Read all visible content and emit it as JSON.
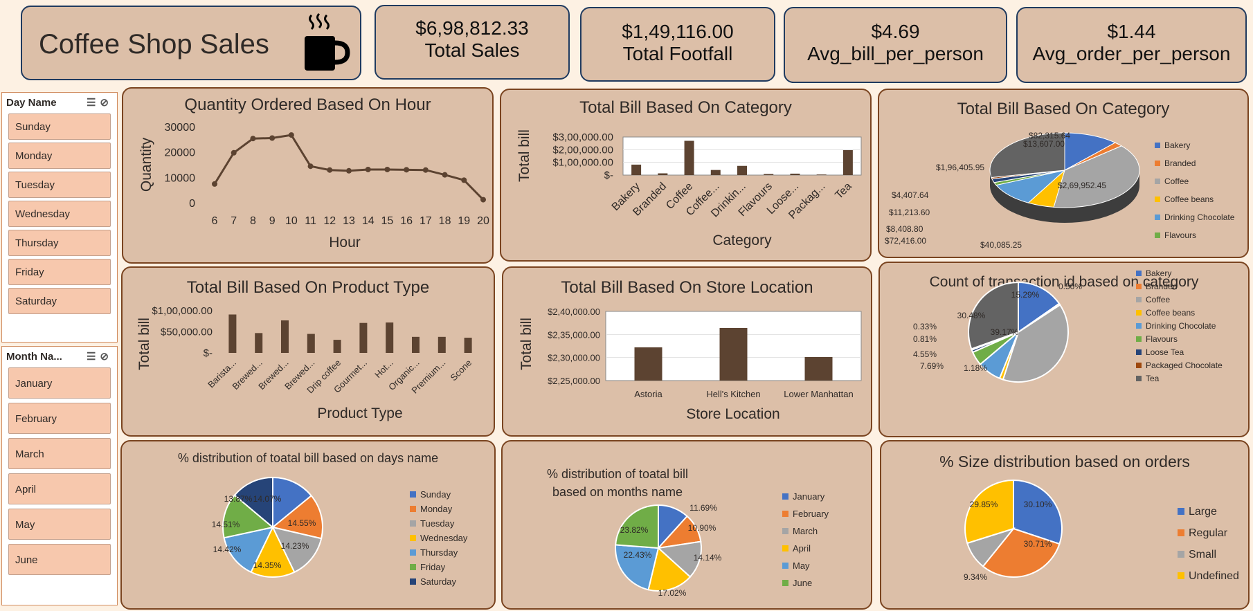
{
  "header": {
    "title": "Coffee Shop Sales",
    "icon": "coffee-cup-icon"
  },
  "kpis": [
    {
      "value": "$6,98,812.33",
      "label": "Total Sales"
    },
    {
      "value": "$1,49,116.00",
      "label": "Total Footfall"
    },
    {
      "value": "$4.69",
      "label": "Avg_bill_per_person"
    },
    {
      "value": "$1.44",
      "label": "Avg_order_per_person"
    }
  ],
  "slicers": {
    "day": {
      "title": "Day Name",
      "items": [
        "Sunday",
        "Monday",
        "Tuesday",
        "Wednesday",
        "Thursday",
        "Friday",
        "Saturday"
      ]
    },
    "month": {
      "title": "Month Na...",
      "items": [
        "January",
        "February",
        "March",
        "April",
        "May",
        "June"
      ]
    }
  },
  "colors": {
    "bar": "#5c4331",
    "line": "#5c4331",
    "palette": [
      "#4472c4",
      "#ed7d31",
      "#a5a5a5",
      "#ffc000",
      "#5b9bd5",
      "#70ad47",
      "#264478",
      "#9e480e",
      "#636363"
    ]
  },
  "chart_data": [
    {
      "id": "qty-hour",
      "type": "line",
      "title": "Quantity Ordered Based On Hour",
      "xlabel": "Hour",
      "ylabel": "Quantity",
      "x": [
        "6",
        "7",
        "8",
        "9",
        "10",
        "11",
        "12",
        "13",
        "14",
        "15",
        "16",
        "17",
        "18",
        "19",
        "20"
      ],
      "values": [
        7400,
        19700,
        25300,
        25500,
        26700,
        14400,
        12900,
        12600,
        13100,
        13100,
        13000,
        12900,
        11000,
        8900,
        1200
      ],
      "ylim": [
        0,
        30000
      ],
      "yticks": [
        "0",
        "10000",
        "20000",
        "30000"
      ]
    },
    {
      "id": "bill-category-bar",
      "type": "bar",
      "title": "Total Bill Based On Category",
      "xlabel": "Category",
      "ylabel": "Total bill",
      "categories": [
        "Bakery",
        "Branded",
        "Coffee",
        "Coffee...",
        "Drinkin...",
        "Flavours",
        "Loose...",
        "Packag...",
        "Tea"
      ],
      "values": [
        82315.64,
        13607.0,
        269952.45,
        40085.25,
        72416.0,
        8408.8,
        11213.6,
        4407.64,
        196405.95
      ],
      "ylim": [
        0,
        300000
      ],
      "yticks": [
        "$-",
        "$1,00,000.00",
        "$2,00,000.00",
        "$3,00,000.00"
      ]
    },
    {
      "id": "bill-category-pie",
      "type": "pie",
      "title": "Total Bill Based On Category",
      "categories": [
        "Bakery",
        "Branded",
        "Coffee",
        "Coffee beans",
        "Drinking Chocolate",
        "Flavours"
      ],
      "values": [
        82315.64,
        13607.0,
        269952.45,
        40085.25,
        72416.0,
        8408.8,
        11213.6,
        4407.64,
        196405.95
      ],
      "labels": [
        "$82,315.64",
        "$13,607.00",
        "$2,69,952.45",
        "$40,085.25",
        "$72,416.00",
        "$8,408.80",
        "$11,213.60",
        "$4,407.64",
        "$1,96,405.95"
      ]
    },
    {
      "id": "bill-product-type",
      "type": "bar",
      "title": "Total Bill Based On Product Type",
      "xlabel": "Product Type",
      "ylabel": "Total bill",
      "categories": [
        "Barista...",
        "Brewed...",
        "Brewed...",
        "Brewed...",
        "Drip coffee",
        "Gourmet...",
        "Hot...",
        "Organic...",
        "Premium...",
        "Scone"
      ],
      "values": [
        91000,
        47000,
        77000,
        45000,
        31000,
        71000,
        72000,
        38000,
        38000,
        36000
      ],
      "ylim": [
        0,
        100000
      ],
      "yticks": [
        "$-",
        "$50,000.00",
        "$1,00,000.00"
      ]
    },
    {
      "id": "bill-store",
      "type": "bar",
      "title": "Total Bill Based On Store Location",
      "xlabel": "Store Location",
      "ylabel": "Total bill",
      "categories": [
        "Astoria",
        "Hell's Kitchen",
        "Lower Manhattan"
      ],
      "values": [
        232200,
        236400,
        230100
      ],
      "ylim": [
        225000,
        240000
      ],
      "yticks": [
        "$2,25,000.00",
        "$2,30,000.00",
        "$2,35,000.00",
        "$2,40,000.00"
      ]
    },
    {
      "id": "txn-category",
      "type": "pie",
      "title": "Count of transaction id based on category",
      "categories": [
        "Bakery",
        "Branded",
        "Coffee",
        "Coffee beans",
        "Drinking Chocolate",
        "Flavours",
        "Loose Tea",
        "Packaged Chocolate",
        "Tea"
      ],
      "values": [
        15.29,
        0.5,
        39.17,
        1.18,
        7.69,
        4.55,
        0.81,
        0.33,
        30.48
      ],
      "labels": [
        "15.29%",
        "0.50%",
        "39.17%",
        "1.18%",
        "7.69%",
        "4.55%",
        "0.81%",
        "0.33%",
        "30.48%"
      ]
    },
    {
      "id": "days-dist",
      "type": "pie",
      "title": "% distribution of toatal bill based on days name",
      "categories": [
        "Sunday",
        "Monday",
        "Tuesday",
        "Wednesday",
        "Thursday",
        "Friday",
        "Saturday"
      ],
      "values": [
        14.07,
        14.55,
        14.23,
        14.35,
        14.42,
        14.51,
        13.87
      ],
      "labels": [
        "14.07%",
        "14.55%",
        "14.23%",
        "14.35%",
        "14.42%",
        "14.51%",
        "13.87%"
      ]
    },
    {
      "id": "months-dist",
      "type": "pie",
      "title": "% distribution of toatal bill based on months name",
      "categories": [
        "January",
        "February",
        "March",
        "April",
        "May",
        "June"
      ],
      "values": [
        11.69,
        10.9,
        14.14,
        17.02,
        22.43,
        23.82
      ],
      "labels": [
        "11.69%",
        "10.90%",
        "14.14%",
        "17.02%",
        "22.43%",
        "23.82%"
      ]
    },
    {
      "id": "size-dist",
      "type": "pie",
      "title": "% Size distribution based on orders",
      "categories": [
        "Large",
        "Regular",
        "Small",
        "Undefined"
      ],
      "values": [
        30.1,
        30.71,
        9.34,
        29.85
      ],
      "labels": [
        "30.10%",
        "30.71%",
        "9.34%",
        "29.85%"
      ]
    }
  ]
}
